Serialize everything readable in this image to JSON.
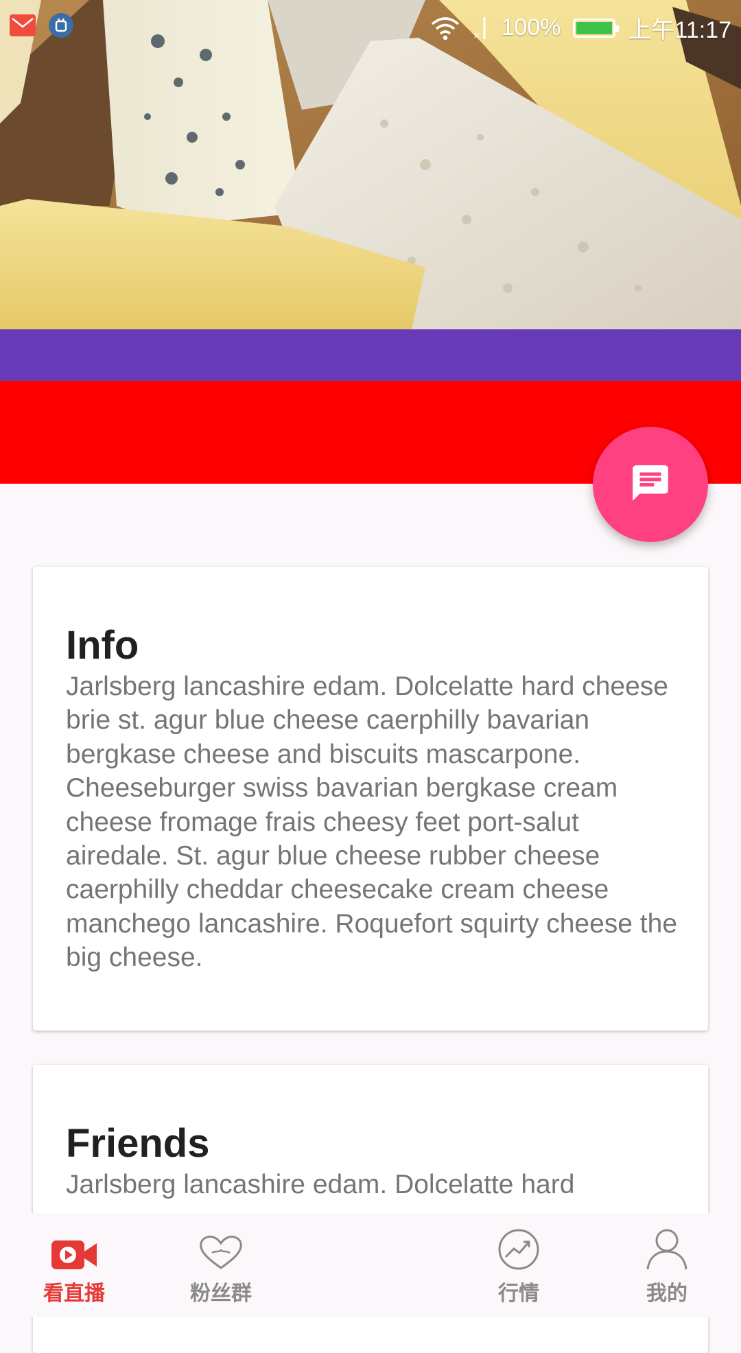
{
  "colors": {
    "purple_band": "#673ab7",
    "red_band": "#ff0000",
    "fab": "#ff4081",
    "nav_active": "#e53935",
    "nav_inactive": "#8a8a8a"
  },
  "status_bar": {
    "battery": "100%",
    "time": "上午11:17",
    "icons": [
      "mail-icon",
      "android-debug-icon",
      "wifi-icon",
      "no-signal-icon",
      "battery-icon"
    ]
  },
  "hero": {
    "image": "cheese-photo"
  },
  "fab": {
    "icon": "message-icon"
  },
  "cards": [
    {
      "title": "Info",
      "body": "Jarlsberg lancashire edam. Dolcelatte hard cheese brie st. agur blue cheese caerphilly bavarian bergkase cheese and biscuits mascarpone. Cheeseburger swiss bavarian bergkase cream cheese fromage frais cheesy feet port-salut airedale. St. agur blue cheese rubber cheese caerphilly cheddar cheesecake cream cheese manchego lancashire. Roquefort squirty cheese the big cheese."
    },
    {
      "title": "Friends",
      "body": "Jarlsberg lancashire edam. Dolcelatte hard"
    }
  ],
  "bottom_nav": {
    "items": [
      {
        "label": "看直播",
        "icon": "video-camera-icon",
        "active": true
      },
      {
        "label": "粉丝群",
        "icon": "heart-icon",
        "active": false
      },
      {
        "label": "行情",
        "icon": "trend-chart-icon",
        "active": false
      },
      {
        "label": "我的",
        "icon": "person-icon",
        "active": false
      }
    ]
  }
}
